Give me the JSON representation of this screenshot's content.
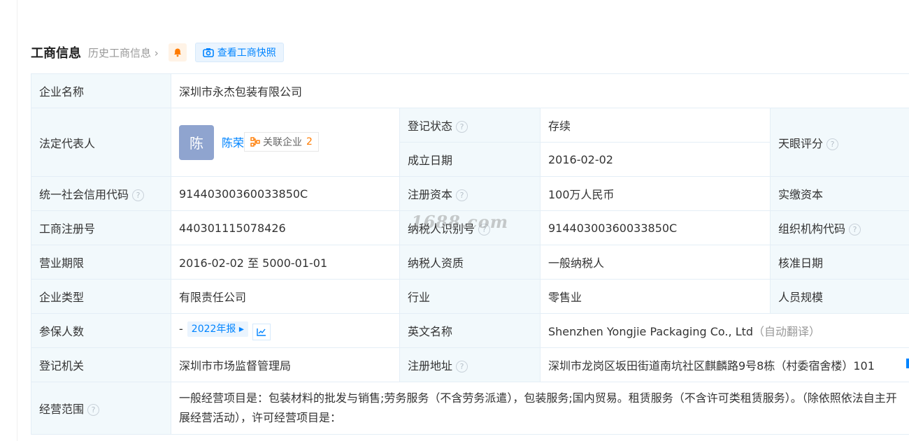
{
  "header": {
    "title": "工商信息",
    "history_link": "历史工商信息",
    "snapshot_button": "查看工商快照"
  },
  "icons": {
    "bell": "bell-icon",
    "camera": "camera-icon",
    "relation": "relation-graph-icon",
    "trend": "trend-chart-icon",
    "help": "question-circle-icon"
  },
  "colors": {
    "accent": "#0084ff",
    "status_green": "#00a35b",
    "label_bg": "#f2f9fc",
    "count_orange": "#ff7b00"
  },
  "help_glyph": "?",
  "company": {
    "name_label": "企业名称",
    "name": "深圳市永杰包装有限公司",
    "legal_rep_label": "法定代表人",
    "legal_rep_avatar": "陈",
    "legal_rep_name": "陈荣",
    "related_label": "关联企业",
    "related_count": "2",
    "reg_status_label": "登记状态",
    "reg_status": "存续",
    "tianyan_label": "天眼评分",
    "found_date_label": "成立日期",
    "found_date": "2016-02-02",
    "credit_code_label": "统一社会信用代码",
    "credit_code": "91440300360033850C",
    "reg_capital_label": "注册资本",
    "reg_capital": "100万人民币",
    "paid_capital_label": "实缴资本",
    "reg_no_label": "工商注册号",
    "reg_no": "440301115078426",
    "taxpayer_id_label": "纳税人识别号",
    "taxpayer_id": "91440300360033850C",
    "org_code_label": "组织机构代码",
    "term_label": "营业期限",
    "term": "2016-02-02 至 5000-01-01",
    "taxpayer_type_label": "纳税人资质",
    "taxpayer_type": "一般纳税人",
    "approve_date_label": "核准日期",
    "type_label": "企业类型",
    "type": "有限责任公司",
    "industry_label": "行业",
    "industry": "零售业",
    "staff_size_label": "人员规模",
    "insured_label": "参保人数",
    "insured": "-",
    "report_year": "2022年报",
    "english_name_label": "英文名称",
    "english_name": "Shenzhen Yongjie Packaging Co., Ltd",
    "auto_translate": "（自动翻译）",
    "authority_label": "登记机关",
    "authority": "深圳市市场监督管理局",
    "address_label": "注册地址",
    "address": "深圳市龙岗区坂田街道南坑社区麒麟路9号8栋（村委宿舍楼）101",
    "scope_label": "经营范围",
    "scope": "一般经营项目是：包装材料的批发与销售;劳务服务（不含劳务派遣），包装服务;国内贸易。租赁服务（不含许可类租赁服务）。（除依照依法自主开展经营活动），许可经营项目是："
  },
  "watermark": "1688.com"
}
